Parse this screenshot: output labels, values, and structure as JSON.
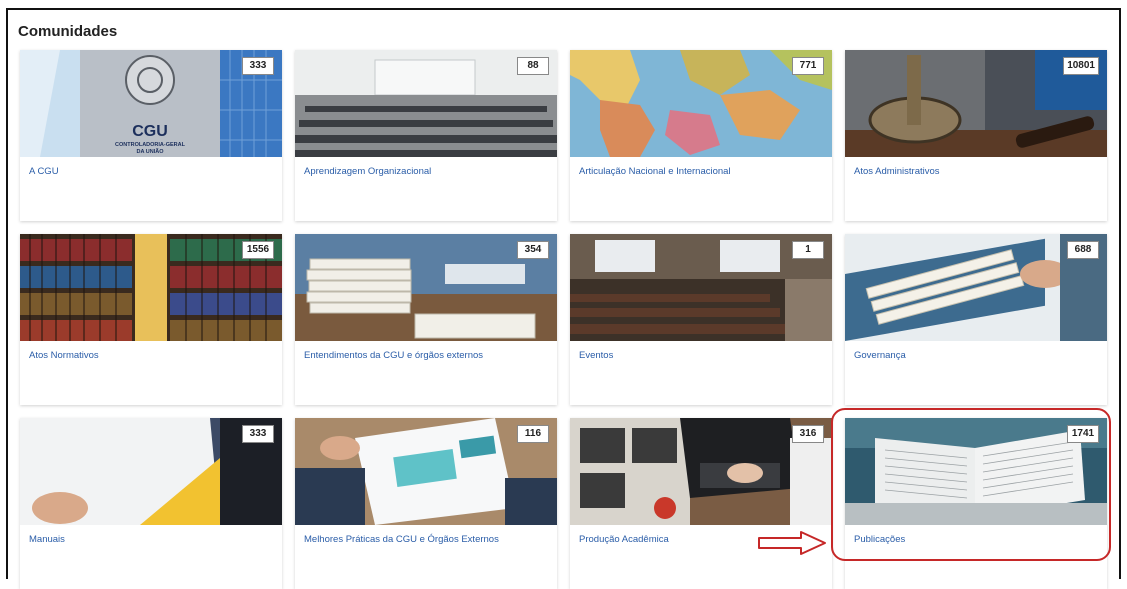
{
  "section": {
    "title": "Comunidades"
  },
  "communities": [
    {
      "title": "A CGU",
      "count": "333",
      "image": "cgu-building"
    },
    {
      "title": "Aprendizagem Organizacional",
      "count": "88",
      "image": "classroom"
    },
    {
      "title": "Articulação Nacional e Internacional",
      "count": "771",
      "image": "world-map"
    },
    {
      "title": "Atos Administrativos",
      "count": "10801",
      "image": "scales-gavel"
    },
    {
      "title": "Atos Normativos",
      "count": "1556",
      "image": "library-shelves"
    },
    {
      "title": "Entendimentos da CGU e órgãos externos",
      "count": "354",
      "image": "document-stacks"
    },
    {
      "title": "Eventos",
      "count": "1",
      "image": "auditorium"
    },
    {
      "title": "Governança",
      "count": "688",
      "image": "file-folders"
    },
    {
      "title": "Manuais",
      "count": "333",
      "image": "binder"
    },
    {
      "title": "Melhores Práticas da CGU e Órgãos Externos",
      "count": "116",
      "image": "reports"
    },
    {
      "title": "Produção Acadêmica",
      "count": "316",
      "image": "laptop-typing"
    },
    {
      "title": "Publicações",
      "count": "1741",
      "image": "open-book"
    }
  ],
  "annotation": {
    "highlighted_item": "Publicações",
    "color": "#c62828"
  },
  "colors": {
    "link": "#2a5da8"
  }
}
